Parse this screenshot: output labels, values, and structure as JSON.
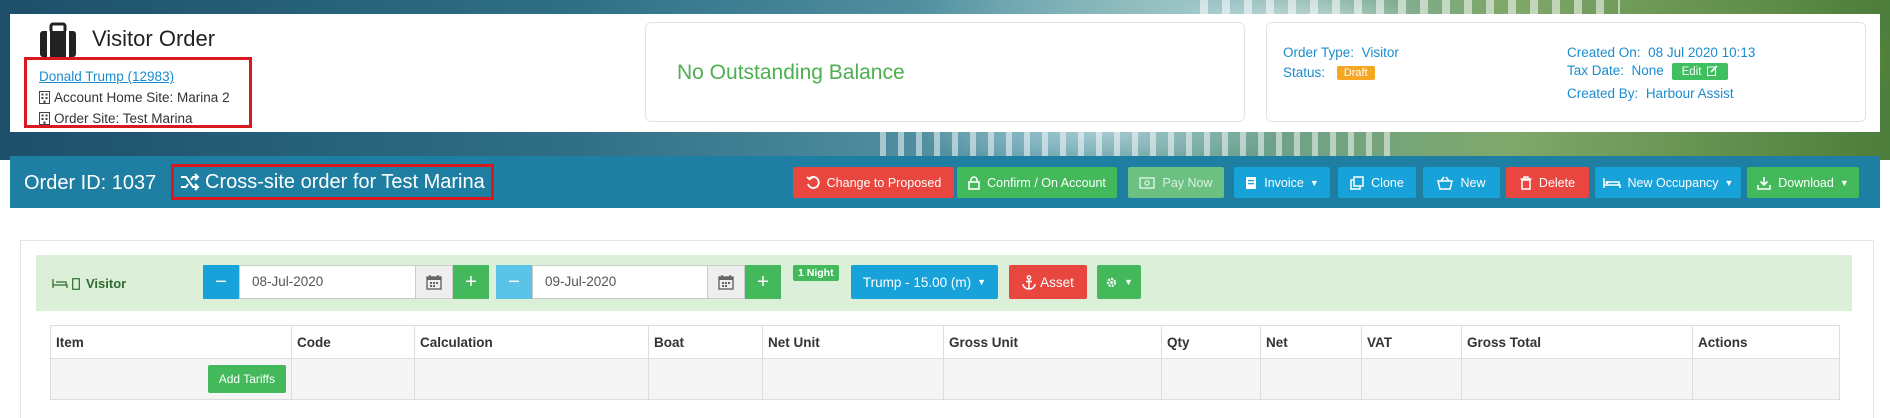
{
  "page": {
    "title": "Visitor Order"
  },
  "customer": {
    "name_link": "Donald Trump (12983)",
    "home_site": "Account Home Site: Marina 2",
    "order_site": "Order Site: Test Marina"
  },
  "balance": {
    "text": "No Outstanding Balance"
  },
  "info": {
    "order_type_label": "Order Type:",
    "order_type_value": "Visitor",
    "status_label": "Status:",
    "status_value": "Draft",
    "created_on_label": "Created On:",
    "created_on_value": "08 Jul 2020 10:13",
    "tax_date_label": "Tax Date:",
    "tax_date_value": "None",
    "edit_label": "Edit",
    "created_by_label": "Created By:",
    "created_by_value": "Harbour Assist"
  },
  "order": {
    "id_label": "Order ID: 1037",
    "cross_site": "Cross-site order for Test Marina"
  },
  "actions": {
    "change_to_proposed": "Change to Proposed",
    "confirm": "Confirm / On Account",
    "pay_now": "Pay Now",
    "invoice": "Invoice",
    "clone": "Clone",
    "new": "New",
    "delete": "Delete",
    "new_occupancy": "New Occupancy",
    "download": "Download"
  },
  "visitor": {
    "label": "Visitor",
    "start_date": "08-Jul-2020",
    "end_date": "09-Jul-2020",
    "nights_badge": "1 Night",
    "boat_button": "Trump - 15.00 (m)",
    "asset_button": "Asset"
  },
  "table": {
    "columns": [
      "Item",
      "Code",
      "Calculation",
      "Boat",
      "Net Unit",
      "Gross Unit",
      "Qty",
      "Net",
      "VAT",
      "Gross Total",
      "Actions"
    ],
    "add_tariffs": "Add Tariffs"
  },
  "colors": {
    "header_blue": "#1f7fa3",
    "accent_green": "#43b95c",
    "accent_red": "#e8463f",
    "accent_blue": "#17a2d9",
    "draft_orange": "#f5a623",
    "highlight_red": "#d9181f"
  },
  "icons": [
    "bag-icon",
    "building-icon",
    "shuffle-icon",
    "undo-icon",
    "lock-icon",
    "money-icon",
    "document-icon",
    "copy-icon",
    "basket-icon",
    "trash-icon",
    "bed-icon",
    "download-icon",
    "calendar-icon",
    "anchor-icon",
    "gear-icon",
    "edit-icon"
  ]
}
